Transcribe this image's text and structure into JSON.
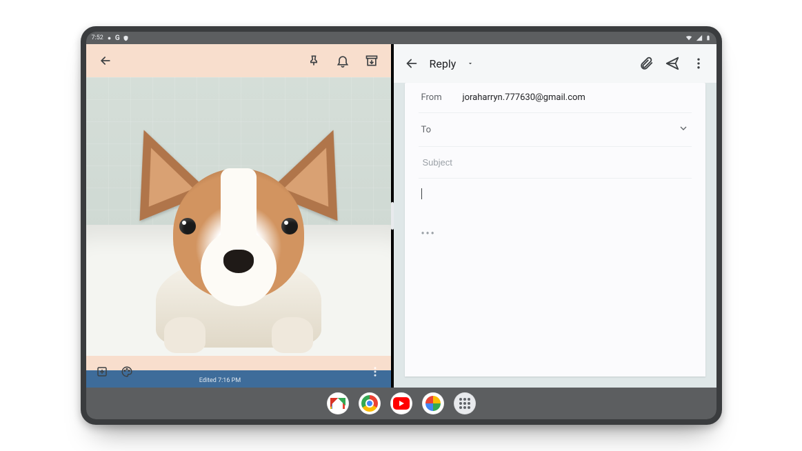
{
  "statusbar": {
    "time": "7:52"
  },
  "keep": {
    "edited_label": "Edited 7:16 PM"
  },
  "mail": {
    "toolbar": {
      "reply_label": "Reply"
    },
    "from_label": "From",
    "from_value": "joraharryn.777630@gmail.com",
    "to_label": "To",
    "to_value": "",
    "subject_placeholder": "Subject",
    "subject_value": "",
    "body_value": "",
    "show_trimmed_label": "•••"
  },
  "dock": {
    "items": [
      {
        "name": "gmail"
      },
      {
        "name": "chrome"
      },
      {
        "name": "youtube"
      },
      {
        "name": "photos"
      },
      {
        "name": "all-apps"
      }
    ]
  }
}
